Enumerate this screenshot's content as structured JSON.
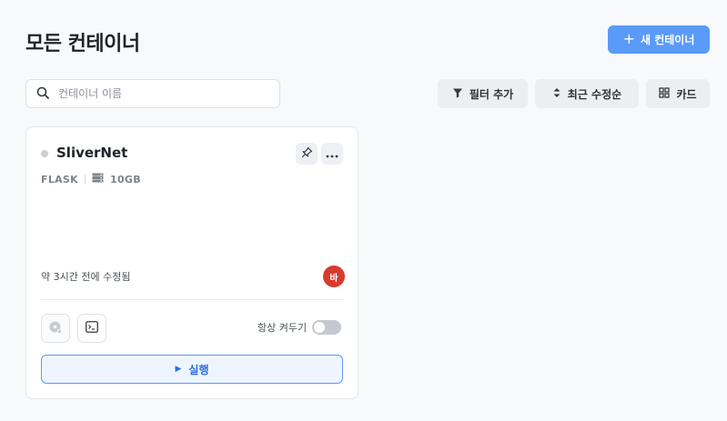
{
  "header": {
    "title": "모든 컨테이너",
    "new_button": "새 컨테이너"
  },
  "search": {
    "placeholder": "컨테이너 이름",
    "value": ""
  },
  "toolbar": {
    "filter_label": "필터 추가",
    "sort_label": "최근 수정순",
    "view_label": "카드"
  },
  "containers": [
    {
      "name": "SliverNet",
      "framework": "FLASK",
      "storage": "10GB",
      "updated": "약 3시간 전에 수정됨",
      "avatar_initial": "바",
      "avatar_color": "#d93a2f",
      "always_on_label": "항상 켜두기",
      "always_on": false,
      "run_label": "실행",
      "status": "stopped"
    }
  ],
  "colors": {
    "accent": "#5a9af8",
    "run_border": "#5b9af5",
    "run_bg": "#eef5ff"
  },
  "icons": [
    "plus-icon",
    "search-icon",
    "filter-icon",
    "sort-icon",
    "grid-icon",
    "pin-icon",
    "more-icon",
    "storage-icon",
    "disk-icon",
    "terminal-icon",
    "play-icon"
  ]
}
